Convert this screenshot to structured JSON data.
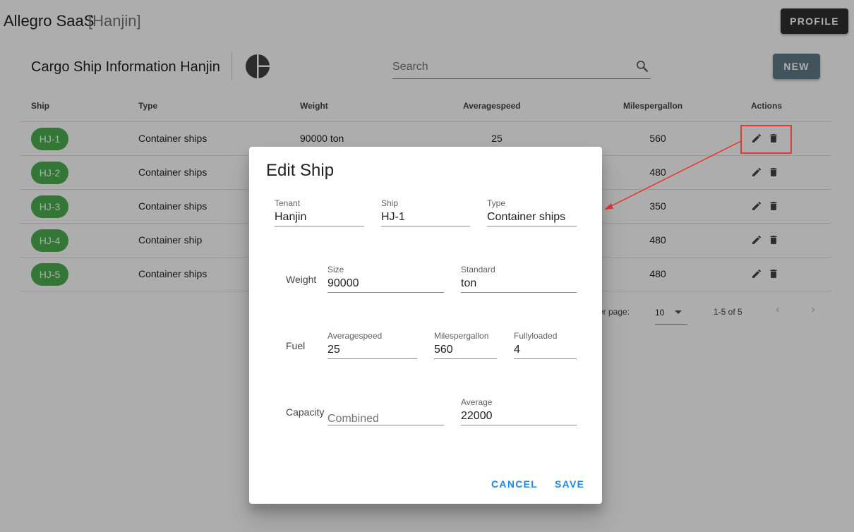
{
  "app": {
    "title": "Allegro SaaS",
    "tenant": "[Hanjin]",
    "profile_label": "PROFILE"
  },
  "panel": {
    "title": "Cargo Ship Information Hanjin",
    "search_placeholder": "Search",
    "new_label": "NEW",
    "columns": [
      "Ship",
      "Type",
      "Weight",
      "Averagespeed",
      "Milespergallon",
      "Actions"
    ],
    "rows": [
      {
        "ship": "HJ-1",
        "type": "Container ships",
        "weight": "90000 ton",
        "averagespeed": "25",
        "milespergallon": "560"
      },
      {
        "ship": "HJ-2",
        "type": "Container ships",
        "weight": "",
        "averagespeed": "",
        "milespergallon": "480"
      },
      {
        "ship": "HJ-3",
        "type": "Container ships",
        "weight": "",
        "averagespeed": "",
        "milespergallon": "350"
      },
      {
        "ship": "HJ-4",
        "type": "Container ship",
        "weight": "",
        "averagespeed": "",
        "milespergallon": "480"
      },
      {
        "ship": "HJ-5",
        "type": "Container ships",
        "weight": "",
        "averagespeed": "",
        "milespergallon": "480"
      }
    ],
    "pagination": {
      "rows_per_page_label": "er page:",
      "rows_per_page": "10",
      "range": "1-5 of 5"
    }
  },
  "dialog": {
    "title": "Edit Ship",
    "tenant": {
      "label": "Tenant",
      "value": "Hanjin"
    },
    "ship": {
      "label": "Ship",
      "value": "HJ-1"
    },
    "type": {
      "label": "Type",
      "value": "Container ships"
    },
    "weight": {
      "group": "Weight",
      "size": {
        "label": "Size",
        "value": "90000"
      },
      "standard": {
        "label": "Standard",
        "value": "ton"
      }
    },
    "fuel": {
      "group": "Fuel",
      "averagespeed": {
        "label": "Averagespeed",
        "value": "25"
      },
      "milespergallon": {
        "label": "Milespergallon",
        "value": "560"
      },
      "fullyloaded": {
        "label": "Fullyloaded",
        "value": "4"
      }
    },
    "capacity": {
      "group": "Capacity",
      "combined": {
        "placeholder": "Combined"
      },
      "average": {
        "label": "Average",
        "value": "22000"
      }
    },
    "cancel_label": "CANCEL",
    "save_label": "SAVE"
  },
  "colors": {
    "chip": "#4caf50",
    "accent": "#1e88e5",
    "new_button": "#607d8b",
    "annotation": "#e53935"
  }
}
